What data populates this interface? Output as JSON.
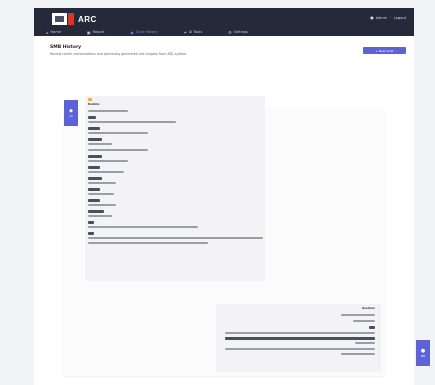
{
  "header": {
    "logo_text": "ARC",
    "nav": [
      {
        "label": "Home",
        "icon": "home-icon",
        "active": false
      },
      {
        "label": "Report",
        "icon": "report-icon",
        "active": false
      },
      {
        "label": "Chat History",
        "icon": "chat-icon",
        "active": true
      },
      {
        "label": "AI Tools",
        "icon": "tools-icon",
        "active": false
      },
      {
        "label": "Settings",
        "icon": "settings-icon",
        "active": false
      }
    ],
    "user_label": "Admin",
    "logout_label": "Logout"
  },
  "page": {
    "title": "SMB History",
    "subtitle": "Review recent conversations and previously generated risk insights from ARC system.",
    "new_button": "+ New Chat"
  },
  "chat": {
    "assistant_avatar_label": "AI",
    "user_avatar_label": "ME",
    "assistant_heading": "Bulletin",
    "user_label": "Question"
  }
}
